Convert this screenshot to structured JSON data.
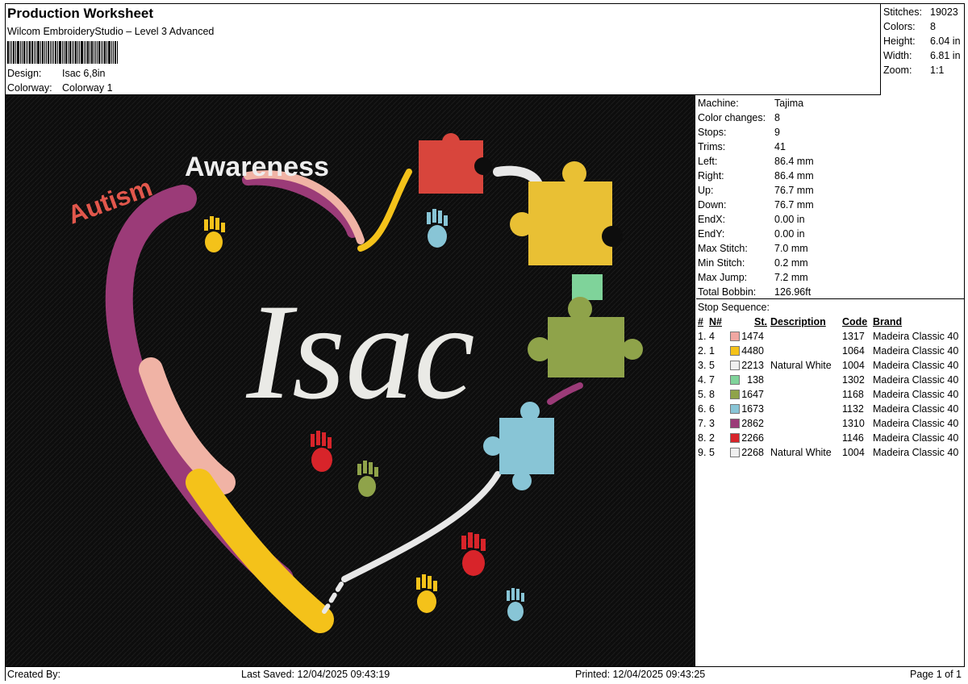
{
  "header": {
    "title": "Production Worksheet",
    "subtitle": "Wilcom EmbroideryStudio – Level 3 Advanced",
    "design_label": "Design:",
    "design_value": "Isac 6,8in",
    "colorway_label": "Colorway:",
    "colorway_value": "Colorway 1"
  },
  "summary": [
    {
      "label": "Stitches:",
      "value": "19023"
    },
    {
      "label": "Colors:",
      "value": "8"
    },
    {
      "label": "Height:",
      "value": "6.04 in"
    },
    {
      "label": "Width:",
      "value": "6.81 in"
    },
    {
      "label": "Zoom:",
      "value": "1:1"
    }
  ],
  "machine": [
    {
      "label": "Machine:",
      "value": "Tajima"
    },
    {
      "label": "Color changes:",
      "value": "8"
    },
    {
      "label": "Stops:",
      "value": "9"
    },
    {
      "label": "Trims:",
      "value": "41"
    },
    {
      "label": "Left:",
      "value": "86.4 mm"
    },
    {
      "label": "Right:",
      "value": "86.4 mm"
    },
    {
      "label": "Up:",
      "value": "76.7 mm"
    },
    {
      "label": "Down:",
      "value": "76.7 mm"
    },
    {
      "label": "EndX:",
      "value": "0.00 in"
    },
    {
      "label": "EndY:",
      "value": "0.00 in"
    },
    {
      "label": "Max Stitch:",
      "value": "7.0 mm"
    },
    {
      "label": "Min Stitch:",
      "value": "0.2 mm"
    },
    {
      "label": "Max Jump:",
      "value": "7.2 mm"
    },
    {
      "label": "Total Bobbin:",
      "value": "126.96ft"
    }
  ],
  "stops": {
    "title": "Stop Sequence:",
    "headers": [
      "#",
      "N#",
      "St.",
      "Description",
      "Code",
      "Brand"
    ],
    "rows": [
      {
        "idx": "1.",
        "n": "4",
        "color": "#f0a7a2",
        "st": "1474",
        "desc": "",
        "code": "1317",
        "brand": "Madeira Classic 40"
      },
      {
        "idx": "2.",
        "n": "1",
        "color": "#f4c21a",
        "st": "4480",
        "desc": "",
        "code": "1064",
        "brand": "Madeira Classic 40"
      },
      {
        "idx": "3.",
        "n": "5",
        "color": "#efefef",
        "st": "2213",
        "desc": "Natural White",
        "code": "1004",
        "brand": "Madeira Classic 40"
      },
      {
        "idx": "4.",
        "n": "7",
        "color": "#7fd39a",
        "st": "138",
        "desc": "",
        "code": "1302",
        "brand": "Madeira Classic 40"
      },
      {
        "idx": "5.",
        "n": "8",
        "color": "#8fa34a",
        "st": "1647",
        "desc": "",
        "code": "1168",
        "brand": "Madeira Classic 40"
      },
      {
        "idx": "6.",
        "n": "6",
        "color": "#88c5d6",
        "st": "1673",
        "desc": "",
        "code": "1132",
        "brand": "Madeira Classic 40"
      },
      {
        "idx": "7.",
        "n": "3",
        "color": "#9b3b78",
        "st": "2862",
        "desc": "",
        "code": "1310",
        "brand": "Madeira Classic 40"
      },
      {
        "idx": "8.",
        "n": "2",
        "color": "#d8242a",
        "st": "2266",
        "desc": "",
        "code": "1146",
        "brand": "Madeira Classic 40"
      },
      {
        "idx": "9.",
        "n": "5",
        "color": "#efefef",
        "st": "2268",
        "desc": "Natural White",
        "code": "1004",
        "brand": "Madeira Classic 40"
      }
    ]
  },
  "design": {
    "headline_word1": "Autism",
    "headline_word2": "Awareness",
    "name": "Isac"
  },
  "footer": {
    "created_by": "Created By:",
    "last_saved": "Last Saved:  12/04/2025 09:43:19",
    "printed": "Printed:  12/04/2025 09:43:25",
    "page": "Page 1 of 1"
  }
}
